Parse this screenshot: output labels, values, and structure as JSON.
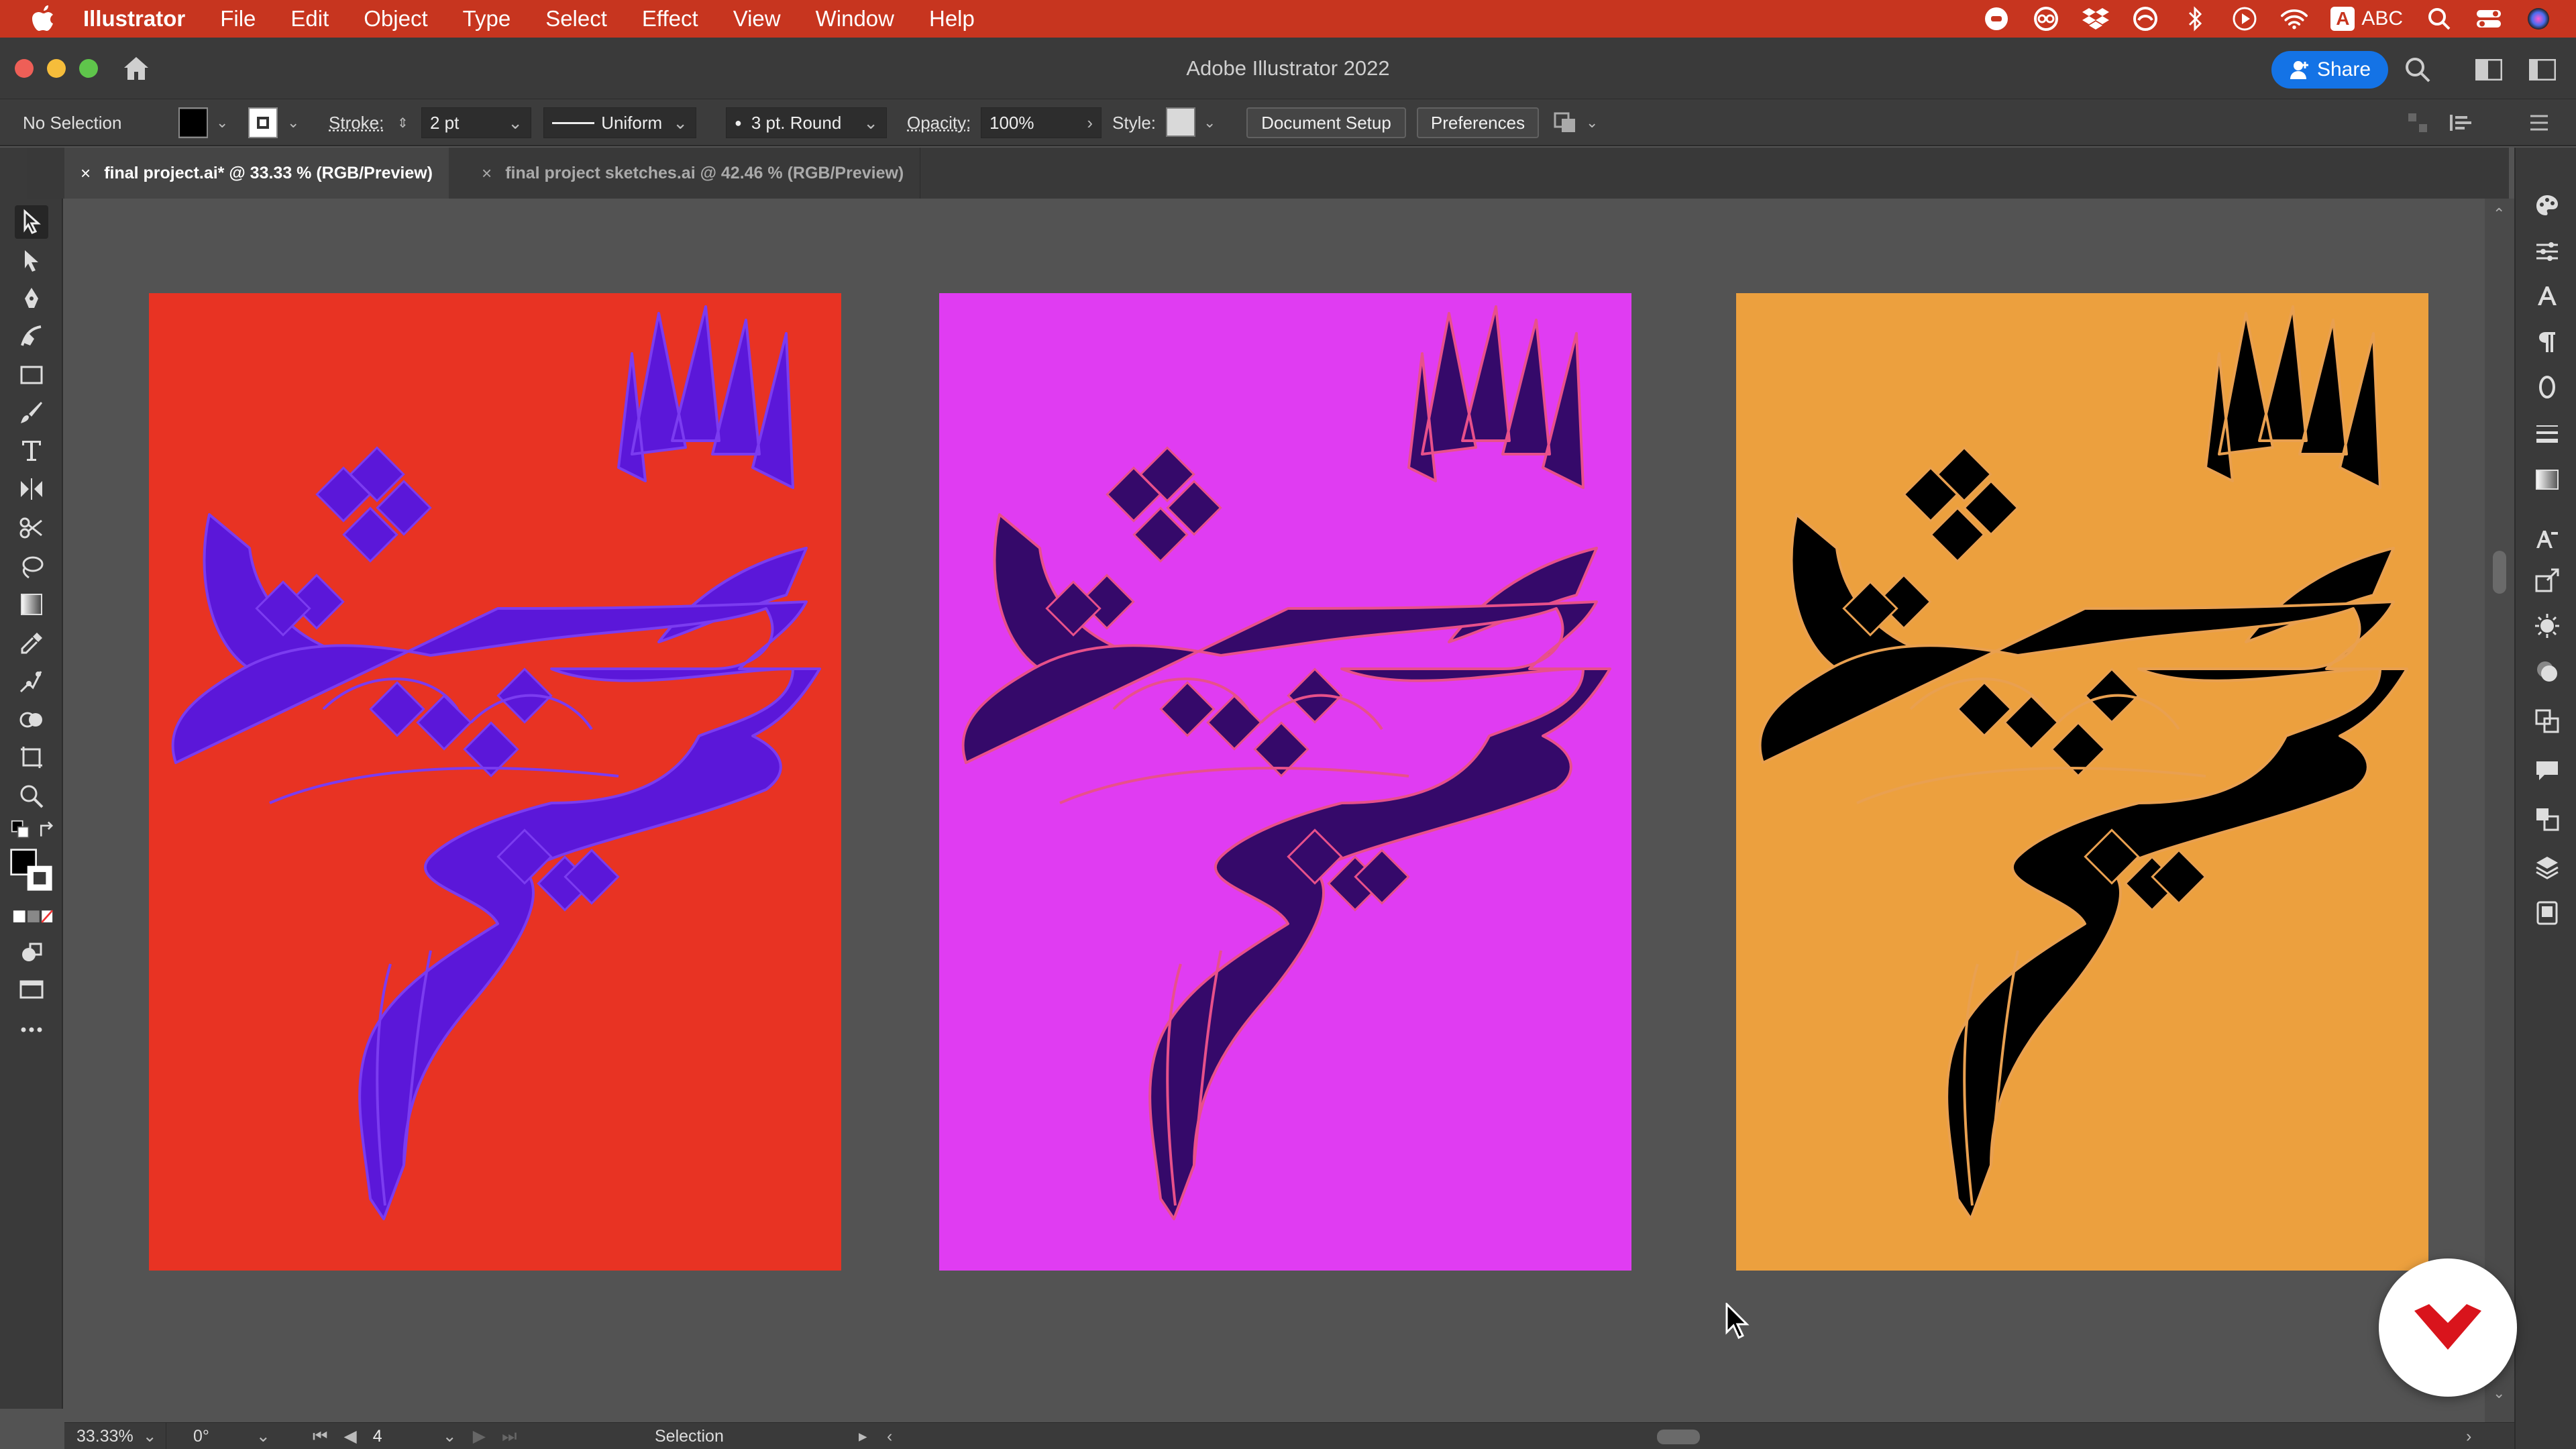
{
  "menubar": {
    "apple_icon": "apple-logo-icon",
    "items": [
      "Illustrator",
      "File",
      "Edit",
      "Object",
      "Type",
      "Select",
      "Effect",
      "View",
      "Window",
      "Help"
    ],
    "status_icons": [
      "record-icon",
      "creative-cloud-icon",
      "dropbox-icon",
      "backup-icon",
      "bluetooth-icon",
      "play-icon",
      "wifi-icon"
    ],
    "keyboard_letter": "A",
    "keyboard_label": "ABC",
    "right_icons": [
      "spotlight-search-icon",
      "control-center-icon",
      "siri-icon"
    ],
    "bar_color": "#c7351f"
  },
  "titlebar": {
    "title": "Adobe Illustrator 2022",
    "share_label": "Share",
    "share_color": "#1473e6"
  },
  "controlbar": {
    "selection_label": "No Selection",
    "stroke_label": "Stroke:",
    "stroke_value": "2 pt",
    "profile_label": "Uniform",
    "brush_label": "3 pt. Round",
    "opacity_label": "Opacity:",
    "opacity_value": "100%",
    "style_label": "Style:",
    "document_setup_label": "Document Setup",
    "preferences_label": "Preferences",
    "fill_color": "#000000",
    "stroke_color": "#ffffff"
  },
  "tabs": [
    {
      "label": "final project.ai* @ 33.33 % (RGB/Preview)",
      "active": true
    },
    {
      "label": "final project sketches.ai @ 42.46 % (RGB/Preview)",
      "active": false
    }
  ],
  "tab_close_glyph": "×",
  "tools": [
    "selection-tool-icon",
    "direct-selection-tool-icon",
    "pen-tool-icon",
    "curvature-tool-icon",
    "rectangle-tool-icon",
    "paintbrush-tool-icon",
    "type-tool-icon",
    "reflect-tool-icon",
    "scissors-tool-icon",
    "lasso-tool-icon",
    "gradient-tool-icon",
    "eyedropper-tool-icon",
    "puppet-warp-tool-icon",
    "shape-builder-tool-icon",
    "artboard-tool-icon",
    "zoom-tool-icon",
    "default-colors-icon",
    "swap-colors-icon",
    "fill-stroke-icon",
    "color-mode-icon",
    "draw-mode-icon",
    "screen-mode-icon",
    "more-tools-icon"
  ],
  "right_panels": [
    "color-panel-icon",
    "properties-panel-icon",
    "character-panel-icon",
    "paragraph-panel-icon",
    "opentype-panel-icon",
    "stroke-panel-icon",
    "gradient-panel-icon",
    "character-styles-icon",
    "asset-export-icon",
    "appearance-panel-icon",
    "graphic-styles-icon",
    "transform-panel-icon",
    "comments-panel-icon",
    "artboards-panel-icon",
    "layers-panel-icon",
    "libraries-panel-icon"
  ],
  "artboards": [
    {
      "name": "artboard-red",
      "background": "#e83323",
      "fill": "#5b17d9",
      "stroke": "#7b3cf0"
    },
    {
      "name": "artboard-magenta",
      "background": "#e03cf2",
      "fill": "#35096a",
      "stroke": "#e8508a"
    },
    {
      "name": "artboard-orange",
      "background": "#eca03e",
      "fill": "#000000",
      "stroke": "#e9a050"
    }
  ],
  "statusbar": {
    "zoom": "33.33%",
    "rotation": "0°",
    "artboard_number": "4",
    "tool_name": "Selection"
  },
  "watermark_icon": "domestika-logo-icon"
}
